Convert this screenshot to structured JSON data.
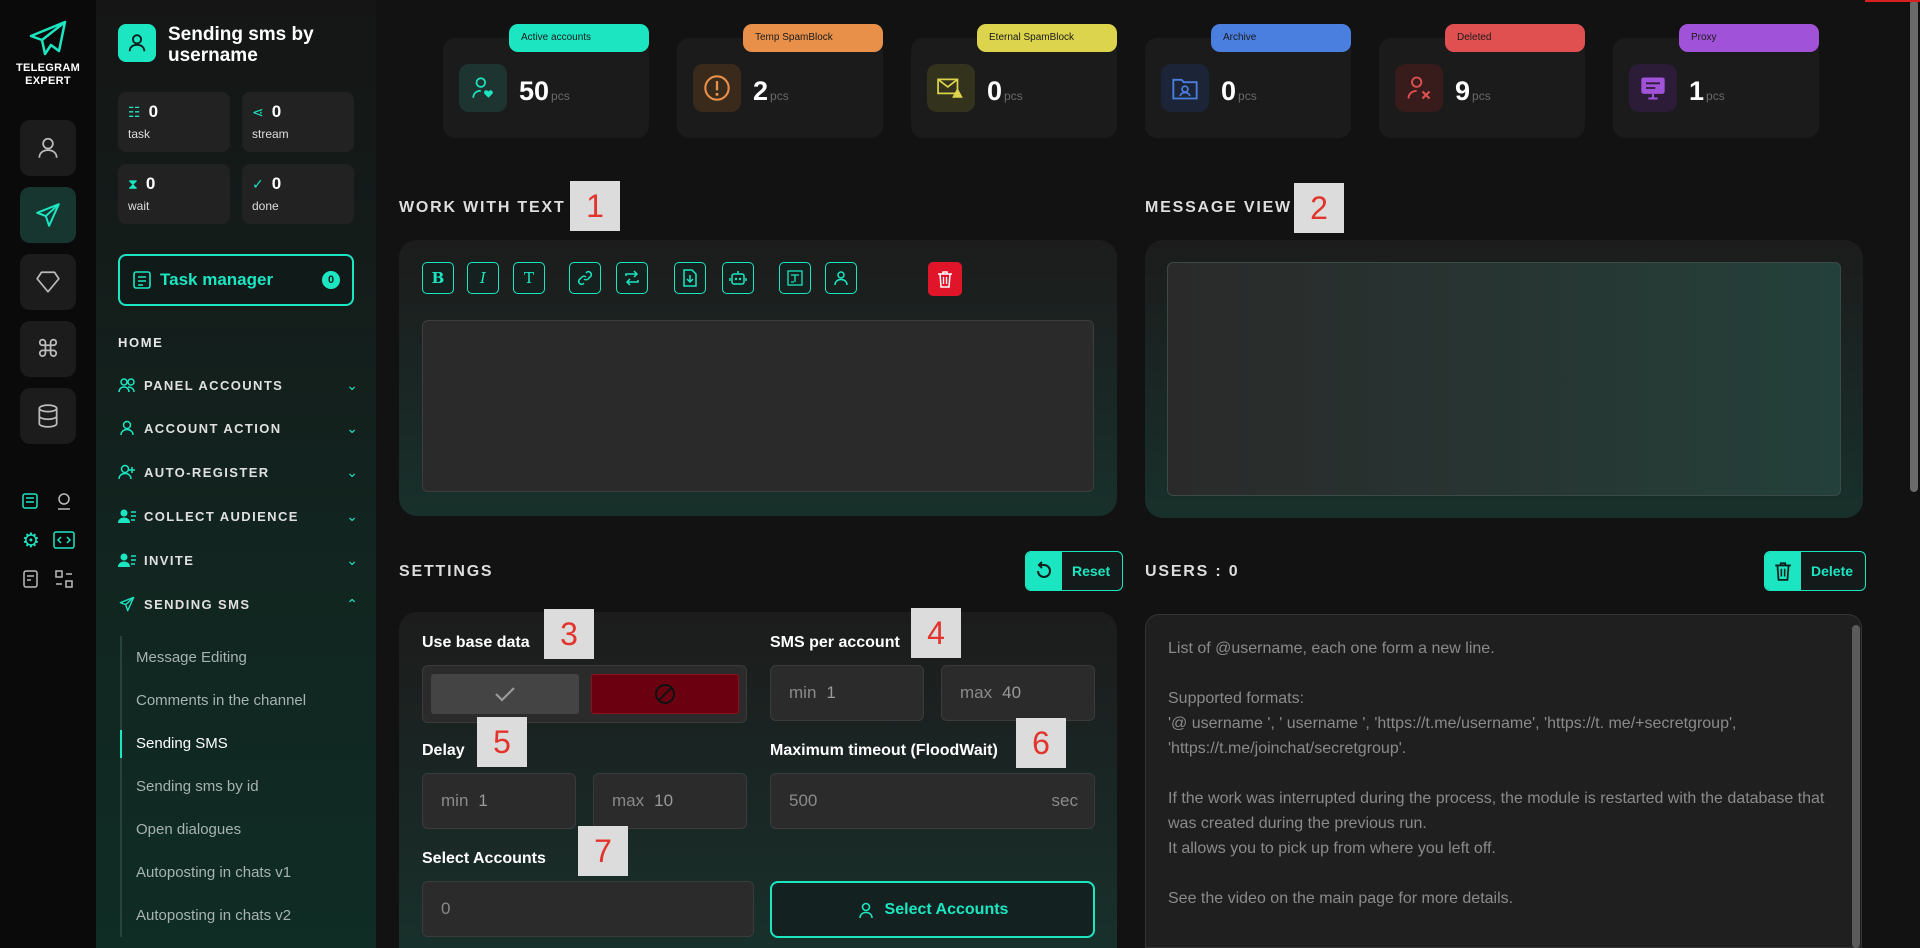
{
  "app": {
    "brand_line1": "TELEGRAM",
    "brand_line2": "EXPERT"
  },
  "sidebar": {
    "title": "Sending sms by username",
    "stats": [
      {
        "key": "task",
        "value": "0",
        "label": "task"
      },
      {
        "key": "stream",
        "value": "0",
        "label": "stream"
      },
      {
        "key": "wait",
        "value": "0",
        "label": "wait"
      },
      {
        "key": "done",
        "value": "0",
        "label": "done"
      }
    ],
    "task_manager": {
      "label": "Task manager",
      "count": "0"
    },
    "home": "HOME",
    "sections": [
      {
        "label": "PANEL ACCOUNTS",
        "icon": "users-icon",
        "expanded": false
      },
      {
        "label": "ACCOUNT ACTION",
        "icon": "user-icon",
        "expanded": false
      },
      {
        "label": "AUTO-REGISTER",
        "icon": "user-plus-icon",
        "expanded": false
      },
      {
        "label": "COLLECT AUDIENCE",
        "icon": "user-list-icon",
        "expanded": false
      },
      {
        "label": "INVITE",
        "icon": "user-list-icon",
        "expanded": false
      },
      {
        "label": "SENDING SMS",
        "icon": "send-icon",
        "expanded": true
      }
    ],
    "sub_items": [
      "Message Editing",
      "Comments in the channel",
      "Sending SMS",
      "Sending sms by id",
      "Open dialogues",
      "Autoposting in chats v1",
      "Autoposting in chats v2"
    ],
    "active_sub_item": "Sending SMS"
  },
  "cards": [
    {
      "label": "Active accounts",
      "value": "50",
      "unit": "pcs",
      "color": "#1ce6c2",
      "icon": "user-heart-icon"
    },
    {
      "label": "Temp SpamBlock",
      "value": "2",
      "unit": "pcs",
      "color": "#e8904a",
      "icon": "alert-circle-icon"
    },
    {
      "label": "Eternal SpamBlock",
      "value": "0",
      "unit": "pcs",
      "color": "#dcd44c",
      "icon": "mail-warning-icon"
    },
    {
      "label": "Archive",
      "value": "0",
      "unit": "pcs",
      "color": "#4a7fe0",
      "icon": "folder-user-icon"
    },
    {
      "label": "Deleted",
      "value": "9",
      "unit": "pcs",
      "color": "#e05050",
      "icon": "user-x-icon"
    },
    {
      "label": "Proxy",
      "value": "1",
      "unit": "pcs",
      "color": "#a052d8",
      "icon": "proxy-icon"
    }
  ],
  "markers": [
    "1",
    "2",
    "3",
    "4",
    "5",
    "6",
    "7"
  ],
  "work_with_text": {
    "title": "WORK WITH TEXT",
    "toolbar": [
      "B",
      "I",
      "T"
    ]
  },
  "message_view": {
    "title": "MESSAGE VIEW"
  },
  "settings": {
    "title": "SETTINGS",
    "reset_label": "Reset",
    "use_base_data": "Use base data",
    "sms_per_account": "SMS per account",
    "sms_min_label": "min",
    "sms_min": "1",
    "sms_max_label": "max",
    "sms_max": "40",
    "delay": "Delay",
    "delay_min_label": "min",
    "delay_min": "1",
    "delay_max_label": "max",
    "delay_max": "10",
    "max_timeout": "Maximum timeout (FloodWait)",
    "timeout_value": "500",
    "timeout_unit": "sec",
    "select_accounts": "Select Accounts",
    "selected_count": "0",
    "select_accounts_button": "Select Accounts"
  },
  "users": {
    "title": "USERS : 0",
    "delete_label": "Delete",
    "placeholder": "List of @username, each one form a new line.\n\nSupported formats:\n'@ username ', ' username ', 'https://t.me/username', 'https://t. me/+secretgroup', 'https://t.me/joinchat/secretgroup'.\n\nIf the work was interrupted during the process, the module is restarted with the database that was created during the previous run.\nIt allows you to pick up from where you left off.\n\nSee the video on the main page for more details."
  }
}
